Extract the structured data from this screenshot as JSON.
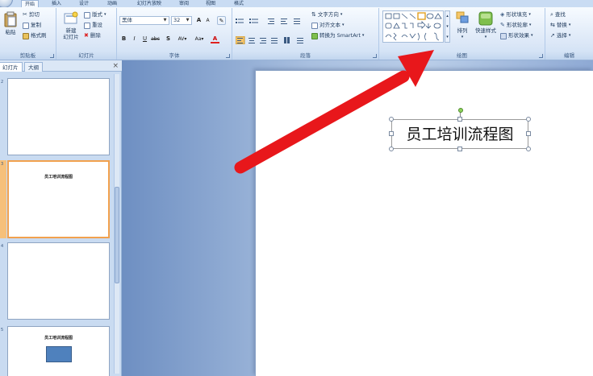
{
  "tabs": [
    "开始",
    "插入",
    "设计",
    "动画",
    "幻灯片放映",
    "审阅",
    "视图",
    "格式"
  ],
  "ribbon": {
    "clipboard": {
      "label": "剪贴板",
      "paste": "粘贴",
      "cut": "剪切",
      "copy": "复制",
      "format_painter": "格式刷"
    },
    "slides": {
      "label": "幻灯片",
      "new_slide_line1": "新建",
      "new_slide_line2": "幻灯片",
      "layout": "版式",
      "reset": "重设",
      "delete": "删除"
    },
    "font": {
      "label": "字体",
      "font_name": "黑体",
      "font_size": "32"
    },
    "paragraph": {
      "label": "段落",
      "text_direction": "文字方向",
      "align_text": "对齐文本",
      "convert_smartart": "转换为 SmartArt"
    },
    "drawing": {
      "label": "绘图",
      "arrange": "排列",
      "quick_styles": "快速样式",
      "shape_fill": "形状填充",
      "shape_outline": "形状轮廓",
      "shape_effects": "形状效果"
    },
    "editing": {
      "label": "编辑",
      "find": "查找",
      "replace": "替换",
      "select": "选择"
    }
  },
  "panel": {
    "tab_slides": "幻灯片",
    "tab_outline": "大纲",
    "close": "×",
    "thumbnails": [
      {
        "title": ""
      },
      {
        "title": "员工培训流程图"
      },
      {
        "title": ""
      },
      {
        "title": "员工培训流程图"
      }
    ]
  },
  "slide": {
    "title": "员工培训流程图"
  },
  "colors": {
    "ribbon_bg": "#dbe7f7",
    "accent_selection": "#f2a14e",
    "arrow": "#e8171b",
    "shape_fill": "#4f81bd"
  }
}
